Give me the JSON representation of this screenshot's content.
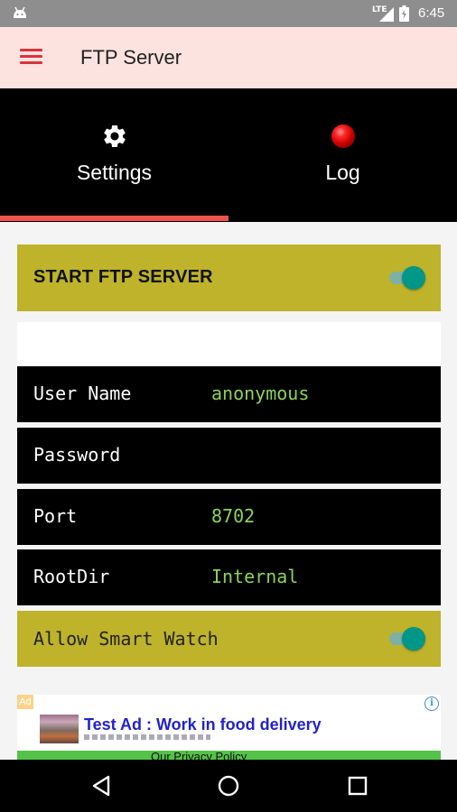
{
  "status_bar": {
    "network": "LTE",
    "time": "6:45",
    "icons": [
      "android-icon",
      "lte-signal-icon",
      "battery-icon"
    ]
  },
  "app_bar": {
    "title": "FTP Server",
    "menu_icon": "hamburger-menu-icon"
  },
  "tabs": [
    {
      "label": "Settings",
      "icon": "gear-icon",
      "selected": true
    },
    {
      "label": "Log",
      "icon": "red-led-icon",
      "selected": false
    }
  ],
  "settings": {
    "start_server": {
      "label": "START FTP SERVER",
      "enabled": true
    },
    "fields": [
      {
        "label": "User Name",
        "value": "anonymous"
      },
      {
        "label": "Password",
        "value": ""
      },
      {
        "label": "Port",
        "value": "8702"
      },
      {
        "label": "RootDir",
        "value": "Internal"
      }
    ],
    "smart_watch": {
      "label": "Allow Smart Watch",
      "enabled": true
    }
  },
  "ad": {
    "badge": "Ad",
    "info": "i",
    "text": "Test Ad : Work in food delivery",
    "footer": "Our Privacy Policy"
  },
  "colors": {
    "status_bar": "#8e8e8e",
    "app_bar": "#fde3df",
    "accent": "#ef5350",
    "menu_icon": "#d8343e",
    "row_olive": "#beb32a",
    "value_green": "#8bd35a",
    "switch_teal": "#009688"
  }
}
